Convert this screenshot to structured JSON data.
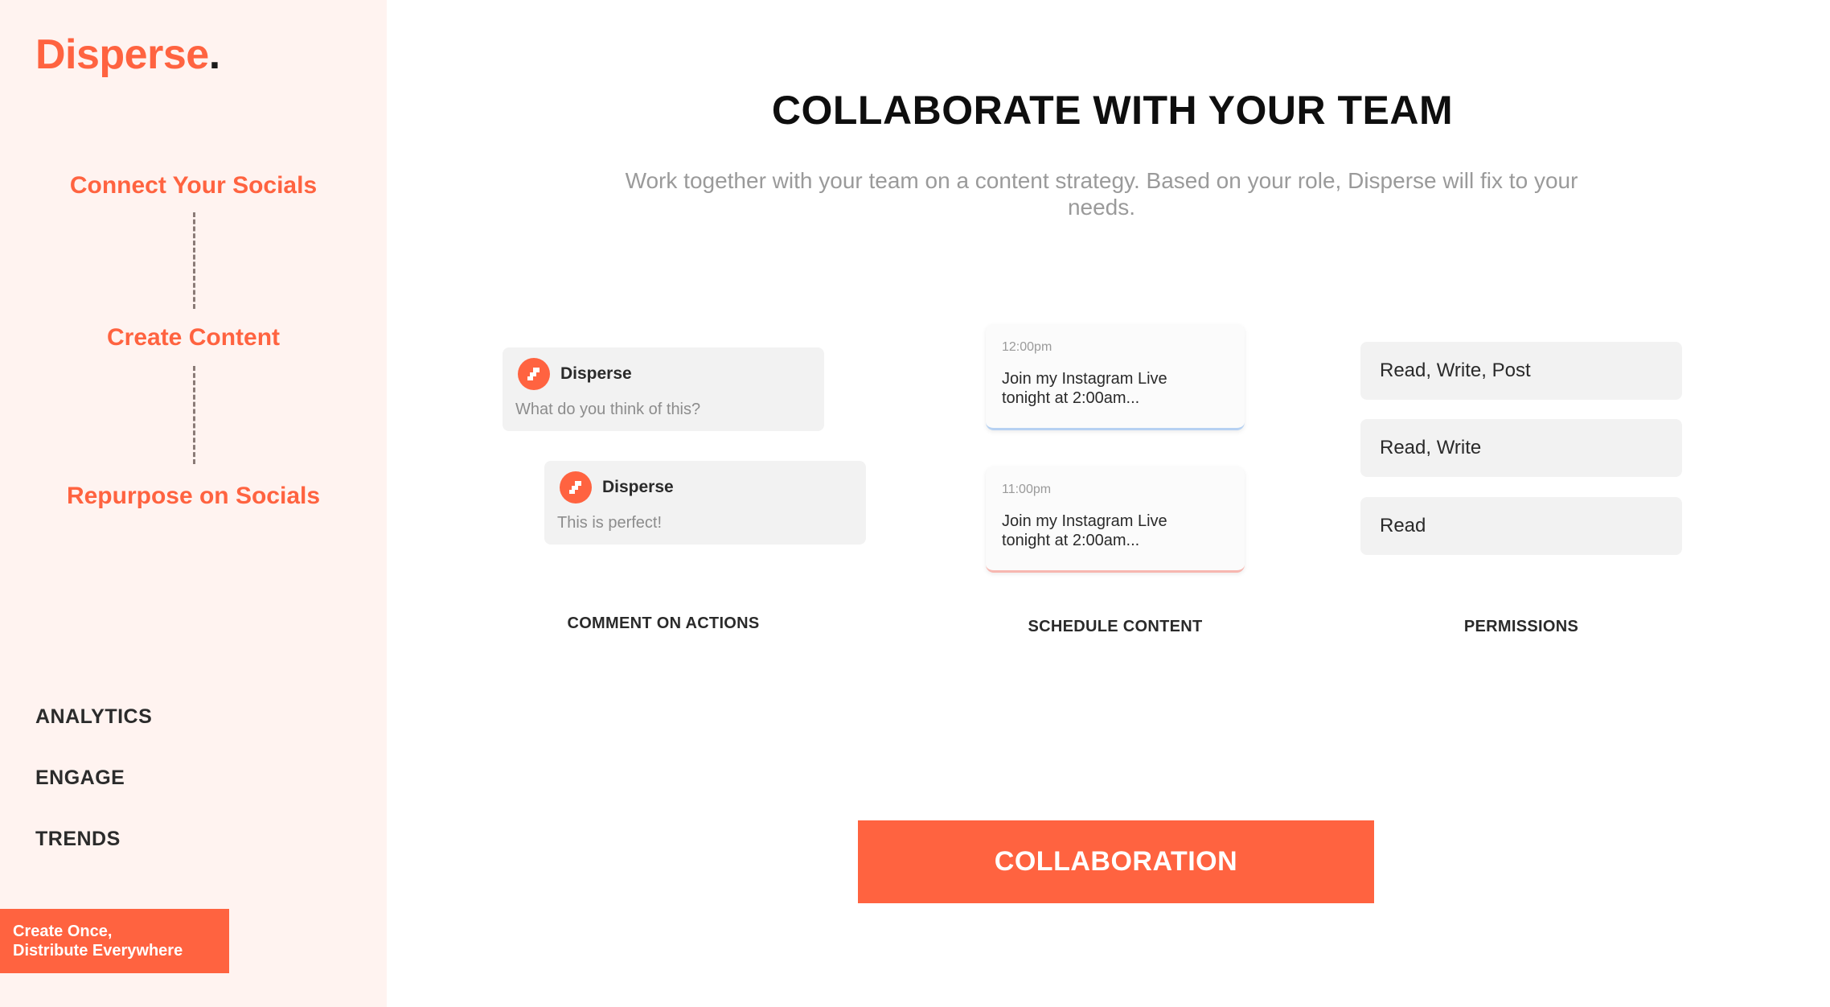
{
  "brand": {
    "name": "Disperse",
    "dot": "."
  },
  "workflow": {
    "steps": [
      "Connect Your Socials",
      "Create Content",
      "Repurpose on Socials"
    ]
  },
  "nav": {
    "items": [
      "ANALYTICS",
      "ENGAGE",
      "TRENDS"
    ]
  },
  "tagline": {
    "line1": "Create Once,",
    "line2": "Distribute Everywhere"
  },
  "main": {
    "title": "COLLABORATE WITH YOUR TEAM",
    "subtitle": "Work together with your team on a content strategy.  Based on your role, Disperse will fix to your needs."
  },
  "comments": [
    {
      "author": "Disperse",
      "text": "What do you think of this?"
    },
    {
      "author": "Disperse",
      "text": "This is perfect!"
    }
  ],
  "schedule": [
    {
      "time": "12:00pm",
      "text": "Join my Instagram Live tonight at 2:00am..."
    },
    {
      "time": "11:00pm",
      "text": "Join my Instagram Live tonight at 2:00am..."
    }
  ],
  "permissions": [
    "Read, Write, Post",
    "Read, Write",
    "Read"
  ],
  "captions": {
    "comments": "COMMENT ON ACTIONS",
    "schedule": "SCHEDULE CONTENT",
    "permissions": "PERMISSIONS"
  },
  "cta": {
    "label": "COLLABORATION"
  },
  "colors": {
    "accent": "#ff6340",
    "sidebar_bg": "#fff3f0",
    "card_bg": "#f2f2f2"
  }
}
